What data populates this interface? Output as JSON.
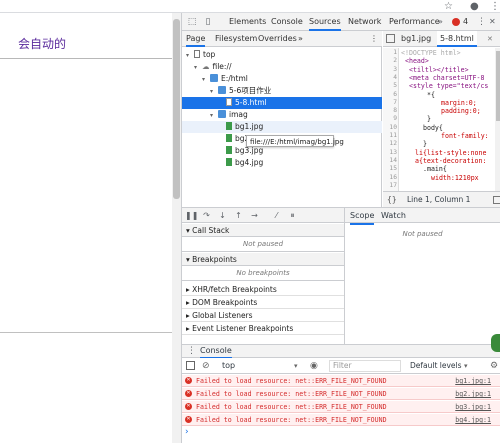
{
  "page": {
    "title": "会自动的"
  },
  "devtools": {
    "main_tabs": [
      "Elements",
      "Console",
      "Sources",
      "Network",
      "Performance"
    ],
    "active_tab": "Sources",
    "error_badge": "4",
    "nav_tabs": [
      "Page",
      "Filesystem",
      "Overrides"
    ],
    "nav_more": "»",
    "tree": [
      {
        "label": "top",
        "level": 0,
        "icon": "frame-icon"
      },
      {
        "label": "file://",
        "level": 1,
        "icon": "cloud-icon"
      },
      {
        "label": "E:/html",
        "level": 2,
        "icon": "folder-icon"
      },
      {
        "label": "5-6项目作业",
        "level": 3,
        "icon": "folder-icon"
      },
      {
        "label": "5-8.html",
        "level": 4,
        "icon": "file-icon",
        "selected": true
      },
      {
        "label": "imag",
        "level": 3,
        "icon": "folder-icon"
      },
      {
        "label": "bg1.jpg",
        "level": 4,
        "icon": "image-file-icon",
        "hover": true
      },
      {
        "label": "bg2.",
        "level": 4,
        "icon": "image-file-icon"
      },
      {
        "label": "bg3.jpg",
        "level": 4,
        "icon": "image-file-icon"
      },
      {
        "label": "bg4.jpg",
        "level": 4,
        "icon": "image-file-icon"
      }
    ],
    "tooltip": "file:///E:/html/imag/bg1.jpg",
    "editor_tabs": [
      "bg1.jpg",
      "5-8.html"
    ],
    "editor_active": "5-8.html",
    "code_lines": [
      "<!DOCTYPE html>",
      "<head>",
      "<tiltl></title>",
      "<meta charset=UTF-8",
      "<style type=\"text/cs",
      "*{",
      "margin:0;",
      "padding:0;",
      "}",
      "body{",
      "font-family:",
      "}",
      "li{list-style:none",
      "a{text-decoration:",
      ".main{",
      "width:1210px"
    ],
    "line_numbers": [
      "1",
      "2",
      "3",
      "4",
      "5",
      "6",
      "7",
      "8",
      "9",
      "10",
      "11",
      "12",
      "13",
      "14",
      "15",
      "16",
      "17"
    ],
    "status": "Line 1, Column 1",
    "status_braces": "{}",
    "scope_tabs": [
      "Scope",
      "Watch"
    ],
    "scope_empty": "Not paused",
    "sections": [
      {
        "label": "Call Stack",
        "expanded": true,
        "empty": "Not paused"
      },
      {
        "label": "Breakpoints",
        "expanded": true,
        "empty": "No breakpoints"
      },
      {
        "label": "XHR/fetch Breakpoints",
        "expanded": false
      },
      {
        "label": "DOM Breakpoints",
        "expanded": false
      },
      {
        "label": "Global Listeners",
        "expanded": false
      },
      {
        "label": "Event Listener Breakpoints",
        "expanded": false
      }
    ],
    "drawer_tab": "Console",
    "console": {
      "context": "top",
      "filter_placeholder": "Filter",
      "levels": "Default levels",
      "errors": [
        {
          "message": "Failed to load resource: net::ERR_FILE_NOT_FOUND",
          "source": "bg1.jpg:1"
        },
        {
          "message": "Failed to load resource: net::ERR_FILE_NOT_FOUND",
          "source": "bg2.jpg:1"
        },
        {
          "message": "Failed to load resource: net::ERR_FILE_NOT_FOUND",
          "source": "bg3.jpg:1"
        },
        {
          "message": "Failed to load resource: net::ERR_FILE_NOT_FOUND",
          "source": "bg4.jpg:1"
        }
      ],
      "prompt": "›"
    }
  },
  "icons": {
    "star": "☆",
    "account": "●",
    "menu": "⋮",
    "close": "✕",
    "more": "⋮",
    "collapse_closed": "▸",
    "collapse_open": "▾"
  },
  "colors": {
    "accent": "#1a73e8",
    "error": "#d93025",
    "page_title": "#5a2a9c"
  }
}
